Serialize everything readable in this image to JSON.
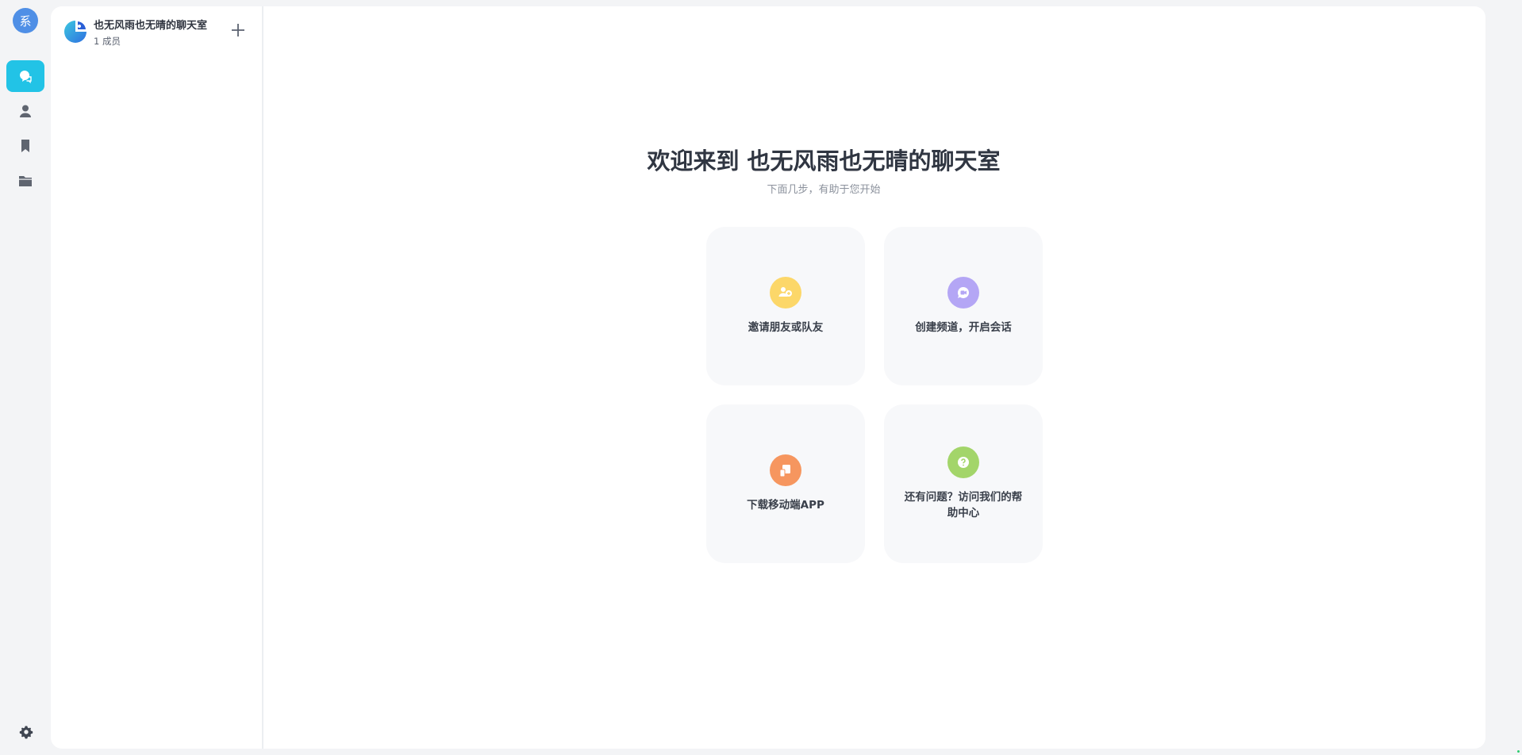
{
  "rail": {
    "avatar_initial": "系",
    "items": [
      {
        "name": "chat",
        "icon": "chat-bubble-icon",
        "active": true
      },
      {
        "name": "contacts",
        "icon": "user-icon",
        "active": false
      },
      {
        "name": "favorites",
        "icon": "bookmark-icon",
        "active": false
      },
      {
        "name": "files",
        "icon": "folder-icon",
        "active": false
      }
    ],
    "settings_icon": "gear-icon",
    "accent_color": "#22c3e6"
  },
  "channel_panel": {
    "group_name": "也无风雨也无晴的聊天室",
    "member_count": "1 成员",
    "add_icon": "plus-icon"
  },
  "welcome": {
    "title": "欢迎来到 也无风雨也无晴的聊天室",
    "subtitle": "下面几步，有助于您开始",
    "tiles": [
      {
        "label": "邀请朋友或队友",
        "icon": "invite-users-icon",
        "color": "#fcd769"
      },
      {
        "label": "创建频道，开启会话",
        "icon": "video-chat-icon",
        "color": "#b4a6f5"
      },
      {
        "label": "下载移动端APP",
        "icon": "mobile-app-icon",
        "color": "#f6965f"
      },
      {
        "label": "还有问题？访问我们的帮助中心",
        "icon": "help-icon",
        "color": "#a3d56a"
      }
    ]
  }
}
